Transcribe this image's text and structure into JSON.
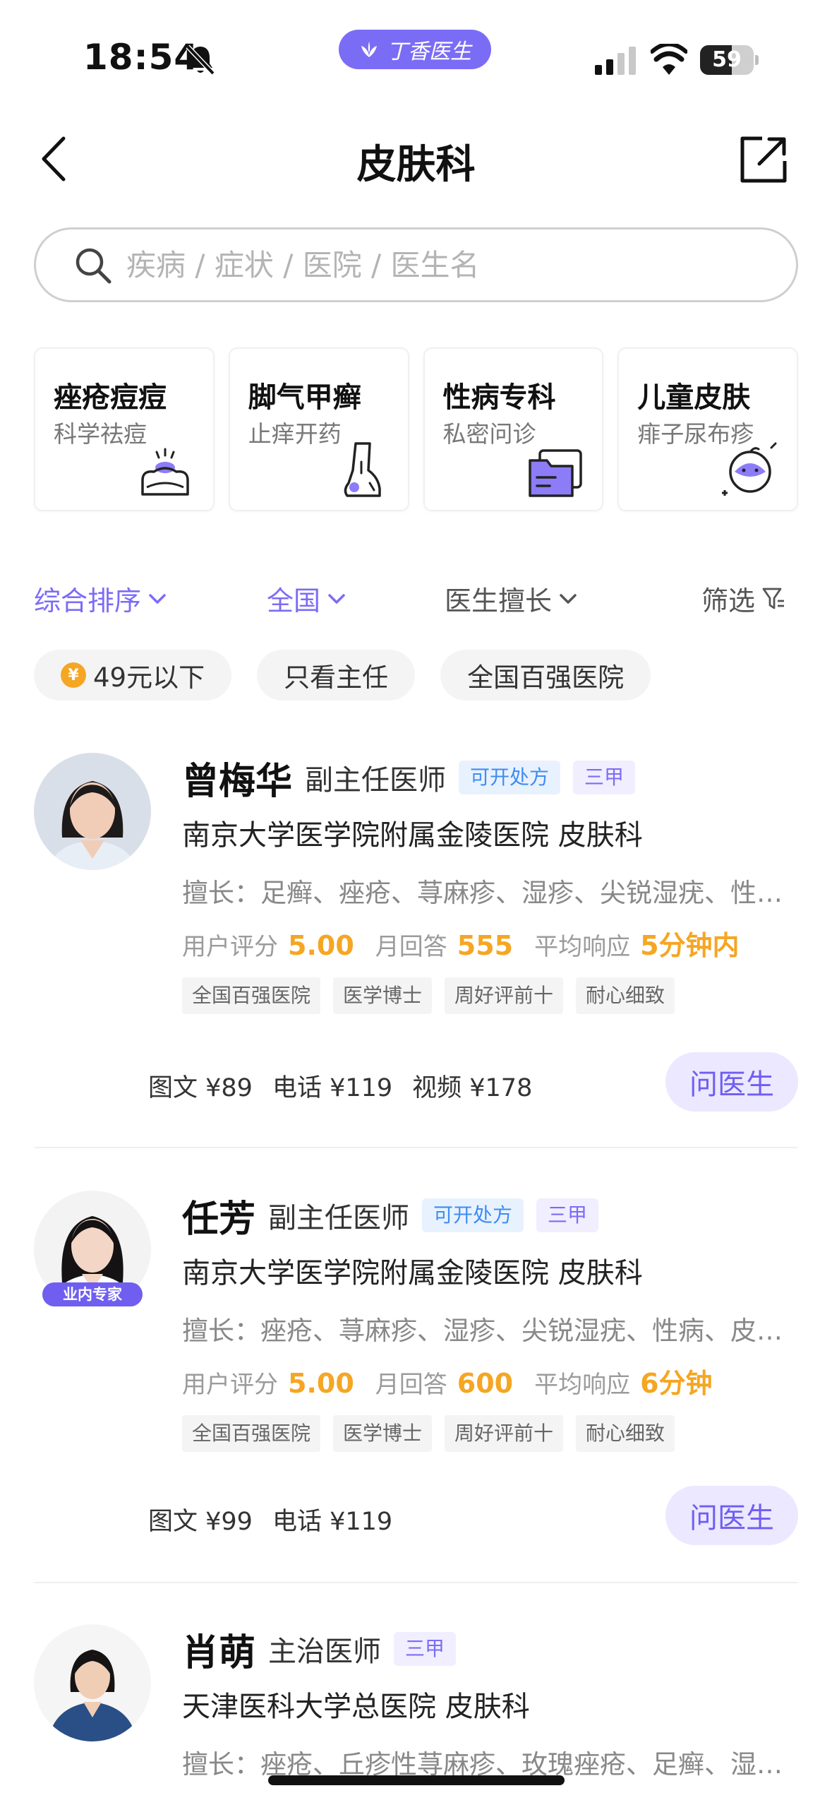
{
  "status_bar": {
    "time": "18:54",
    "app_label": "丁香医生",
    "battery": "59",
    "battery_level": 0.59
  },
  "header": {
    "title": "皮肤科"
  },
  "search": {
    "placeholder": "疾病 / 症状 / 医院 / 医生名"
  },
  "categories": [
    {
      "title": "痤疮痘痘",
      "subtitle": "科学祛痘",
      "icon": "pimple-skin-icon"
    },
    {
      "title": "脚气甲癣",
      "subtitle": "止痒开药",
      "icon": "foot-icon"
    },
    {
      "title": "性病专科",
      "subtitle": "私密问诊",
      "icon": "folder-icon"
    },
    {
      "title": "儿童皮肤",
      "subtitle": "痱子尿布疹",
      "icon": "baby-face-icon"
    }
  ],
  "filters": {
    "sort": "综合排序",
    "region": "全国",
    "expertise": "医生擅长",
    "filter": "筛选"
  },
  "chips": {
    "coin_symbol": "¥",
    "price": "49元以下",
    "director": "只看主任",
    "top_hospitals": "全国百强医院"
  },
  "doctors": [
    {
      "name": "曾梅华",
      "title": "副主任医师",
      "rx_badge": "可开处方",
      "grade_badge": "三甲",
      "hospital": "南京大学医学院附属金陵医院  皮肤科",
      "specialty": "擅长：足癣、痤疮、荨麻疹、湿疹、尖锐湿疣、性病、带状疱疹",
      "rating_label": "用户评分",
      "rating": "5.00",
      "answers_label": "月回答",
      "answers": "555",
      "response_label": "平均响应",
      "response": "5分钟内",
      "tags": [
        "全国百强医院",
        "医学博士",
        "周好评前十",
        "耐心细致"
      ],
      "prices": [
        "图文 ¥89",
        "电话 ¥119",
        "视频 ¥178"
      ],
      "ask_label": "问医生"
    },
    {
      "name": "任芳",
      "title": "副主任医师",
      "rx_badge": "可开处方",
      "grade_badge": "三甲",
      "avatar_badge": "业内专家",
      "hospital": "南京大学医学院附属金陵医院  皮肤科",
      "specialty": "擅长：痤疮、荨麻疹、湿疹、尖锐湿疣、性病、皮炎、足癣",
      "rating_label": "用户评分",
      "rating": "5.00",
      "answers_label": "月回答",
      "answers": "600",
      "response_label": "平均响应",
      "response": "6分钟",
      "tags": [
        "全国百强医院",
        "医学博士",
        "周好评前十",
        "耐心细致"
      ],
      "prices": [
        "图文 ¥99",
        "电话 ¥119"
      ],
      "ask_label": "问医生"
    },
    {
      "name": "肖萌",
      "title": "主治医师",
      "grade_badge": "三甲",
      "hospital": "天津医科大学总医院  皮肤科",
      "specialty": "擅长：痤疮、丘疹性荨麻疹、玫瑰痤疮、足癣、湿疹、皮炎"
    }
  ],
  "colors": {
    "accent": "#7b6cf6",
    "orange": "#f5a623",
    "rx_blue": "#3f8cf2"
  }
}
